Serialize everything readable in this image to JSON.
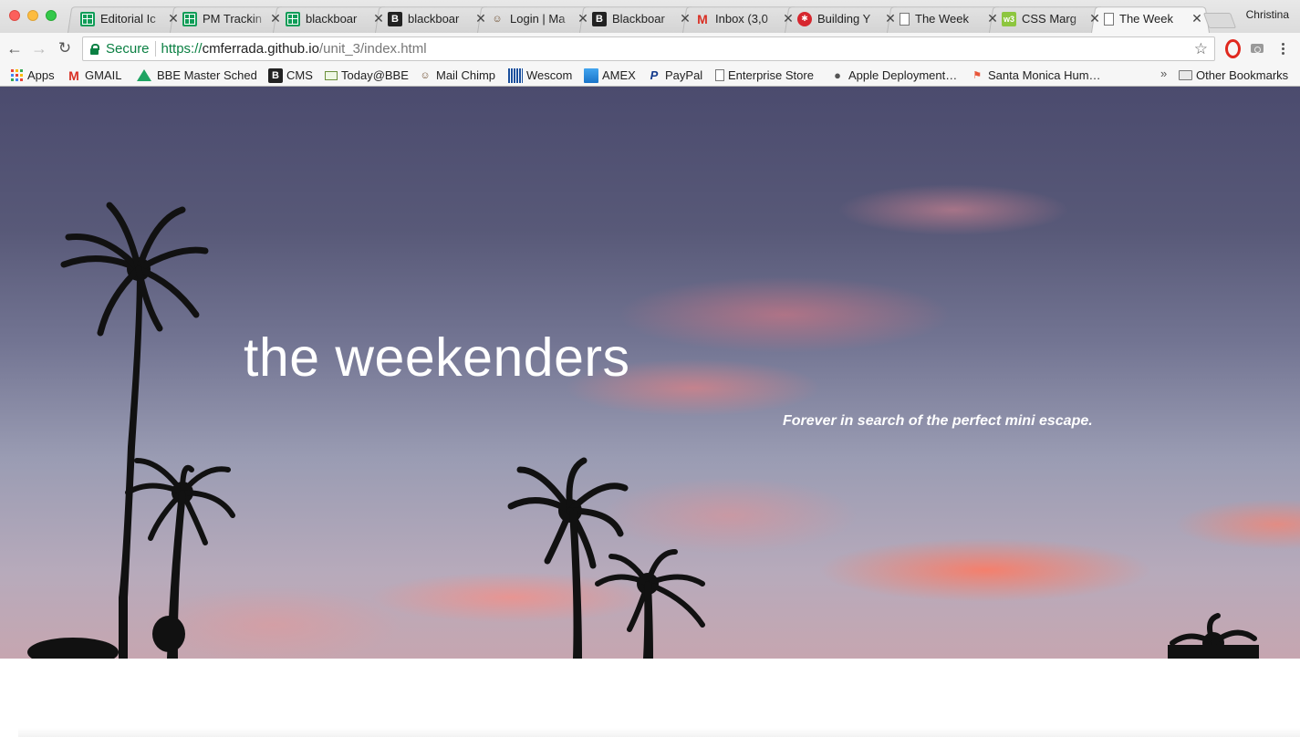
{
  "window": {
    "profile_name": "Christina"
  },
  "tabs": [
    {
      "title": "Editorial Ic",
      "icon": "sheets-icon"
    },
    {
      "title": "PM Trackin",
      "icon": "sheets-icon"
    },
    {
      "title": "blackboar",
      "icon": "sheets-icon"
    },
    {
      "title": "blackboar",
      "icon": "blackboard-icon"
    },
    {
      "title": "Login | Ma",
      "icon": "mailchimp-icon"
    },
    {
      "title": "Blackboar",
      "icon": "blackboard-icon"
    },
    {
      "title": "Inbox (3,0",
      "icon": "gmail-icon"
    },
    {
      "title": "Building Y",
      "icon": "building-icon"
    },
    {
      "title": "The Week",
      "icon": "document-icon"
    },
    {
      "title": "CSS Marg",
      "icon": "css-icon"
    },
    {
      "title": "The Week",
      "icon": "document-icon",
      "active": true
    }
  ],
  "toolbar": {
    "secure_label": "Secure",
    "url_scheme": "https://",
    "url_host": "cmferrada.github.io",
    "url_path": "/unit_3/index.html"
  },
  "bookmarks": {
    "items": [
      {
        "label": "Apps",
        "icon": "apps-grid-icon"
      },
      {
        "label": "GMAIL",
        "icon": "gmail-icon"
      },
      {
        "label": "BBE Master Sched",
        "icon": "drive-icon"
      },
      {
        "label": "CMS",
        "icon": "blackboard-icon"
      },
      {
        "label": "Today@BBE",
        "icon": "mail-icon"
      },
      {
        "label": "Mail Chimp",
        "icon": "mailchimp-icon"
      },
      {
        "label": "Wescom",
        "icon": "wescom-icon"
      },
      {
        "label": "AMEX",
        "icon": "amex-icon"
      },
      {
        "label": "PayPal",
        "icon": "paypal-icon"
      },
      {
        "label": "Enterprise Store",
        "icon": "document-icon"
      },
      {
        "label": "Apple Deployment…",
        "icon": "apple-icon"
      },
      {
        "label": "Santa Monica Hum…",
        "icon": "flag-icon"
      }
    ],
    "overflow": "»",
    "other_bookmarks": "Other Bookmarks"
  },
  "page": {
    "title": "the weekenders",
    "tagline": "Forever in search of the perfect mini escape."
  },
  "colors": {
    "secure_green": "#0b8043",
    "tab_bar": "#dcdcdc",
    "sky_top": "#4b4b6e",
    "cloud_pink": "#ff7a5f"
  }
}
